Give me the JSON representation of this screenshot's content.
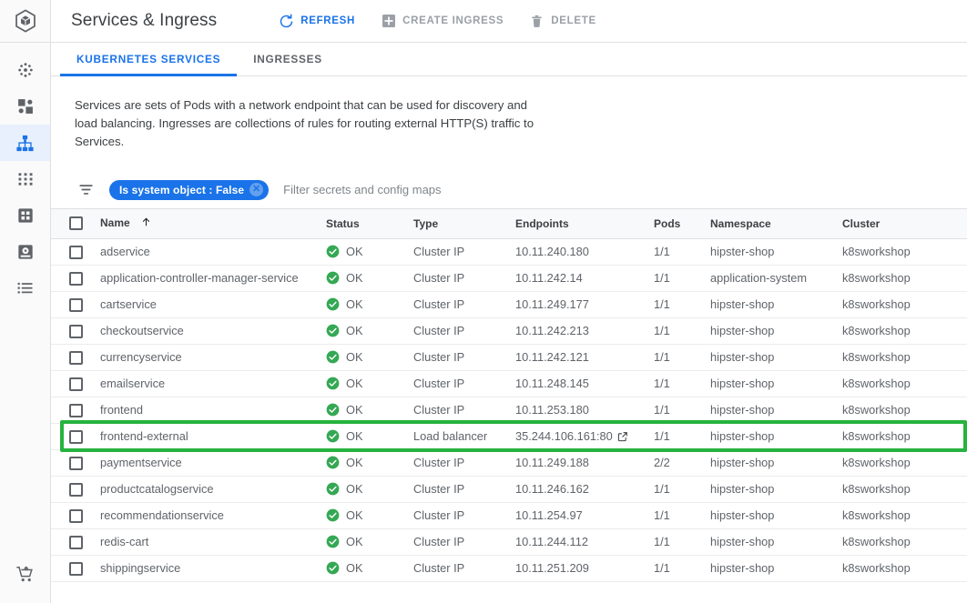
{
  "header": {
    "title": "Services & Ingress",
    "logo_icon": "gke-hexagon-cube-logo",
    "actions": [
      {
        "label": "REFRESH",
        "icon": "refresh-icon",
        "enabled": true
      },
      {
        "label": "CREATE INGRESS",
        "icon": "plus-box-icon",
        "enabled": false
      },
      {
        "label": "DELETE",
        "icon": "trash-icon",
        "enabled": false
      }
    ]
  },
  "sidebar": {
    "items": [
      {
        "icon": "clusters-icon",
        "name": "clusters",
        "selected": false
      },
      {
        "icon": "workloads-icon",
        "name": "workloads",
        "selected": false
      },
      {
        "icon": "services-ingress-icon",
        "name": "services-ingress",
        "selected": true
      },
      {
        "icon": "applications-icon",
        "name": "applications",
        "selected": false
      },
      {
        "icon": "configuration-icon",
        "name": "configuration",
        "selected": false
      },
      {
        "icon": "storage-icon",
        "name": "storage",
        "selected": false
      },
      {
        "icon": "object-browser-icon",
        "name": "object-browser",
        "selected": false
      }
    ],
    "bottom_item": {
      "icon": "marketplace-cart-icon",
      "name": "marketplace"
    }
  },
  "tabs": [
    {
      "label": "KUBERNETES SERVICES",
      "active": true
    },
    {
      "label": "INGRESSES",
      "active": false
    }
  ],
  "description": "Services are sets of Pods with a network endpoint that can be used for discovery and load balancing. Ingresses are collections of rules for routing external HTTP(S) traffic to Services.",
  "filter": {
    "icon": "filter-list-icon",
    "chip_label": "Is system object : False",
    "chip_remove_icon": "close-circle-icon",
    "placeholder": "Filter secrets and config maps"
  },
  "table": {
    "select_all_checkbox": false,
    "sort_column": "Name",
    "sort_direction": "asc",
    "sort_icon": "arrow-up-icon",
    "columns": [
      "Name",
      "Status",
      "Type",
      "Endpoints",
      "Pods",
      "Namespace",
      "Cluster"
    ],
    "rows": [
      {
        "name": "adservice",
        "status": "OK",
        "type": "Cluster IP",
        "endpoint": "10.11.240.180",
        "external": false,
        "pods": "1/1",
        "namespace": "hipster-shop",
        "cluster": "k8sworkshop"
      },
      {
        "name": "application-controller-manager-service",
        "status": "OK",
        "type": "Cluster IP",
        "endpoint": "10.11.242.14",
        "external": false,
        "pods": "1/1",
        "namespace": "application-system",
        "cluster": "k8sworkshop"
      },
      {
        "name": "cartservice",
        "status": "OK",
        "type": "Cluster IP",
        "endpoint": "10.11.249.177",
        "external": false,
        "pods": "1/1",
        "namespace": "hipster-shop",
        "cluster": "k8sworkshop"
      },
      {
        "name": "checkoutservice",
        "status": "OK",
        "type": "Cluster IP",
        "endpoint": "10.11.242.213",
        "external": false,
        "pods": "1/1",
        "namespace": "hipster-shop",
        "cluster": "k8sworkshop"
      },
      {
        "name": "currencyservice",
        "status": "OK",
        "type": "Cluster IP",
        "endpoint": "10.11.242.121",
        "external": false,
        "pods": "1/1",
        "namespace": "hipster-shop",
        "cluster": "k8sworkshop"
      },
      {
        "name": "emailservice",
        "status": "OK",
        "type": "Cluster IP",
        "endpoint": "10.11.248.145",
        "external": false,
        "pods": "1/1",
        "namespace": "hipster-shop",
        "cluster": "k8sworkshop"
      },
      {
        "name": "frontend",
        "status": "OK",
        "type": "Cluster IP",
        "endpoint": "10.11.253.180",
        "external": false,
        "pods": "1/1",
        "namespace": "hipster-shop",
        "cluster": "k8sworkshop"
      },
      {
        "name": "frontend-external",
        "status": "OK",
        "type": "Load balancer",
        "endpoint": "35.244.106.161:80",
        "external": true,
        "pods": "1/1",
        "namespace": "hipster-shop",
        "cluster": "k8sworkshop",
        "highlighted": true
      },
      {
        "name": "paymentservice",
        "status": "OK",
        "type": "Cluster IP",
        "endpoint": "10.11.249.188",
        "external": false,
        "pods": "2/2",
        "namespace": "hipster-shop",
        "cluster": "k8sworkshop"
      },
      {
        "name": "productcatalogservice",
        "status": "OK",
        "type": "Cluster IP",
        "endpoint": "10.11.246.162",
        "external": false,
        "pods": "1/1",
        "namespace": "hipster-shop",
        "cluster": "k8sworkshop"
      },
      {
        "name": "recommendationservice",
        "status": "OK",
        "type": "Cluster IP",
        "endpoint": "10.11.254.97",
        "external": false,
        "pods": "1/1",
        "namespace": "hipster-shop",
        "cluster": "k8sworkshop"
      },
      {
        "name": "redis-cart",
        "status": "OK",
        "type": "Cluster IP",
        "endpoint": "10.11.244.112",
        "external": false,
        "pods": "1/1",
        "namespace": "hipster-shop",
        "cluster": "k8sworkshop"
      },
      {
        "name": "shippingservice",
        "status": "OK",
        "type": "Cluster IP",
        "endpoint": "10.11.251.209",
        "external": false,
        "pods": "1/1",
        "namespace": "hipster-shop",
        "cluster": "k8sworkshop"
      }
    ]
  },
  "colors": {
    "accent_blue": "#1a73e8",
    "status_green": "#34a853",
    "highlight_green": "#26b33f",
    "disabled_gray": "#9aa0a6"
  }
}
